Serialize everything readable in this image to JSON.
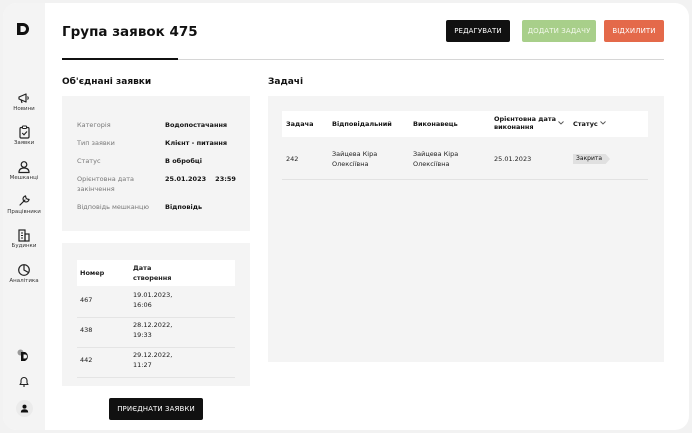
{
  "sidebar": {
    "logo": "D",
    "items": [
      {
        "label": "Новини",
        "icon": "megaphone-icon"
      },
      {
        "label": "Заявки",
        "icon": "clipboard-icon"
      },
      {
        "label": "Мешканці",
        "icon": "residents-icon"
      },
      {
        "label": "Працівники",
        "icon": "wrench-icon"
      },
      {
        "label": "Будинки",
        "icon": "building-icon"
      },
      {
        "label": "Аналітика",
        "icon": "pie-chart-icon"
      }
    ],
    "bottom": [
      "chat-icon",
      "bell-icon",
      "user-icon"
    ]
  },
  "header": {
    "title": "Група заявок 475",
    "buttons": {
      "edit": "РЕДАГУВАТИ",
      "add_task": "ДОДАТИ ЗАДАЧУ",
      "reject": "ВІДХИЛИТИ"
    }
  },
  "merged": {
    "title": "Об'єднані заявки",
    "info": [
      {
        "key": "Категорія",
        "value": "Водопостачання"
      },
      {
        "key": "Тип заявки",
        "value": "Клієнт - питання"
      },
      {
        "key": "Статус",
        "value": "В обробці"
      },
      {
        "key": "Орієнтовна дата закінчення",
        "value": "25.01.2023    23:59"
      },
      {
        "key": "Відповідь мешканцю",
        "value": "Відповідь"
      }
    ],
    "requests": {
      "headers": [
        "Номер",
        "Дата створення"
      ],
      "rows": [
        {
          "number": "467",
          "date": "19.01.2023, 16:06"
        },
        {
          "number": "438",
          "date": "28.12.2022, 19:33"
        },
        {
          "number": "442",
          "date": "29.12.2022, 11:27"
        }
      ]
    },
    "attach_button": "ПРИЄДНАТИ ЗАЯВКИ"
  },
  "tasks": {
    "title": "Задачі",
    "headers": {
      "task": "Задача",
      "responsible": "Відповідальний",
      "executor": "Виконавець",
      "due": "Орієнтовна дата виконання",
      "status": "Статус"
    },
    "rows": [
      {
        "task": "242",
        "responsible": "Зайцева Кіра Олексіївна",
        "executor": "Зайцева Кіра Олексіївна",
        "due": "25.01.2023",
        "status": "Закрита"
      }
    ]
  },
  "colors": {
    "accent_green": "#a8cf8a",
    "accent_red": "#e4694a",
    "dark": "#111111"
  }
}
